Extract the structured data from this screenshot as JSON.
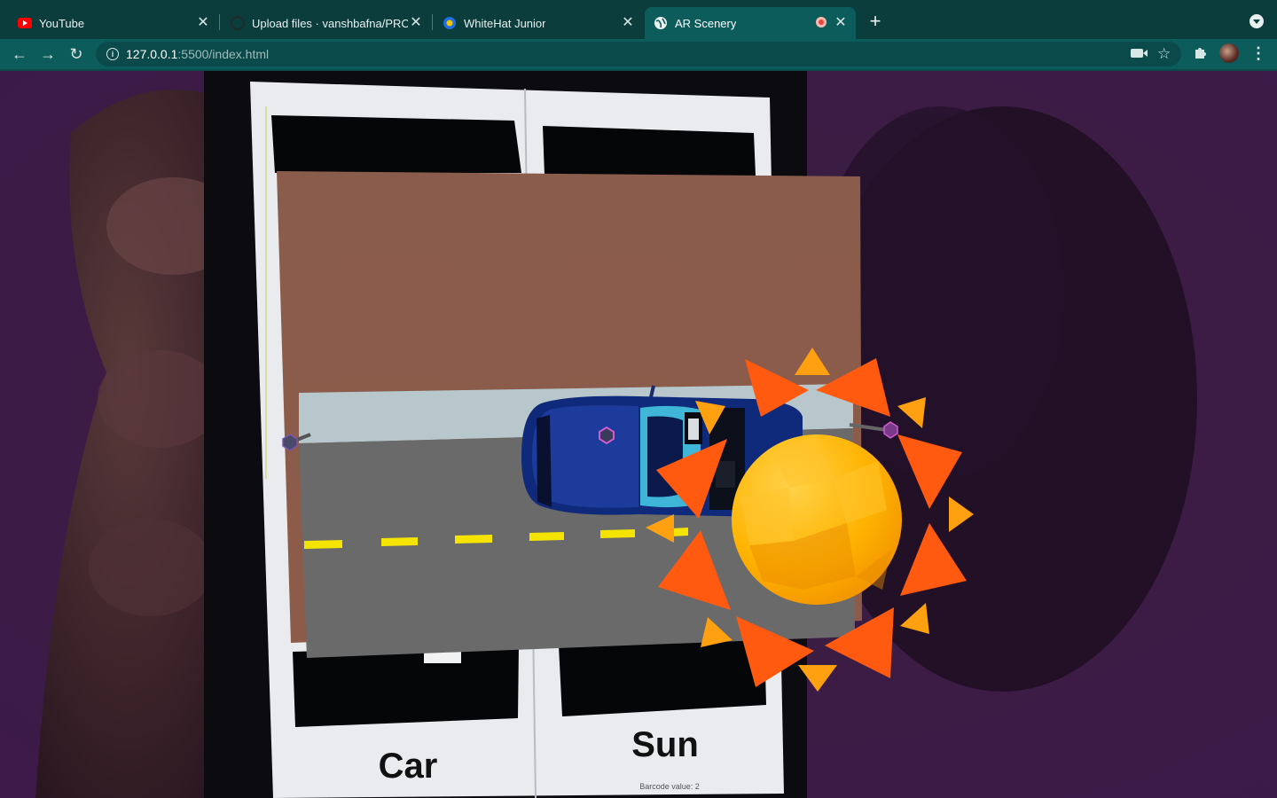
{
  "tabs": [
    {
      "title": "YouTube",
      "icon": "youtube-icon"
    },
    {
      "title": "Upload files · vanshbafna/PRO",
      "icon": "github-icon"
    },
    {
      "title": "WhiteHat Junior",
      "icon": "whitehat-icon"
    },
    {
      "title": "AR Scenery",
      "icon": "globe-icon",
      "active": true,
      "recording": true
    }
  ],
  "address": {
    "host": "127.0.0.1",
    "path": ":5500/index.html"
  },
  "scene": {
    "marker_labels": [
      "Car",
      "Sun"
    ],
    "barcode_caption": "Barcode value: 2"
  },
  "colors": {
    "tabbar": "#0b3d3d",
    "toolbar": "#0d5c5c",
    "backdrop": "#8a5a4a",
    "road": "#6a6a6a",
    "lane": "#f5e400",
    "sun": "#ffb000",
    "rays": "#ff5a10"
  }
}
